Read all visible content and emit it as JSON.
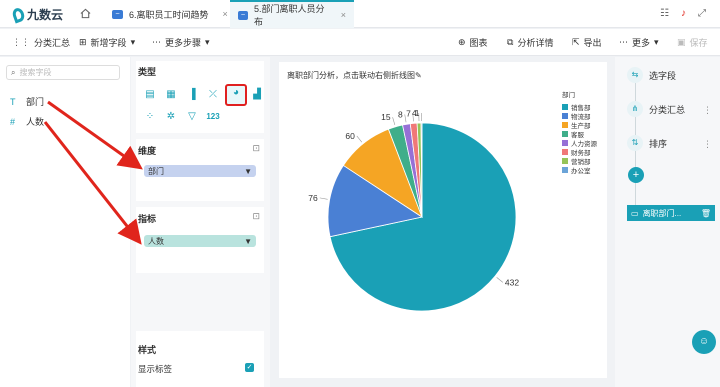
{
  "app": {
    "logo": "九数云"
  },
  "tabs": [
    {
      "label": "6.离职员工时间趋势",
      "icon": "chart-icon"
    },
    {
      "label": "5.部门离职人员分布",
      "icon": "chart-icon"
    }
  ],
  "toolbar": {
    "group_summary": "分类汇总",
    "add_field": "新增字段",
    "more_steps": "更多步骤",
    "chart": "图表",
    "analysis_detail": "分析详情",
    "export": "导出",
    "more": "更多",
    "save": "保存"
  },
  "left_panel": {
    "search_placeholder": "搜索字段",
    "fields": [
      {
        "type_icon": "T",
        "name": "部门"
      },
      {
        "type_icon": "#",
        "name": "人数"
      }
    ]
  },
  "mid_panel": {
    "type_title": "类型",
    "dimension_title": "维度",
    "dimension_value": "部门",
    "metric_title": "指标",
    "metric_value": "人数",
    "style_title": "样式",
    "show_label": "显示标签"
  },
  "chart_title": "离职部门分析，点击联动右侧折线图",
  "colors": {
    "accent": "#1aa0b6",
    "dimension_bg": "#c5d2ef",
    "metric_bg": "#b9e3de",
    "annotation": "#e0251c"
  },
  "chart_data": {
    "type": "pie",
    "legend_title": "部门",
    "categories": [
      "销售部",
      "物流部",
      "生产部",
      "客服",
      "人力资源",
      "财务部",
      "营销部",
      "办公室"
    ],
    "values": [
      432,
      76,
      60,
      15,
      8,
      7,
      4,
      1
    ],
    "colors": [
      "#1aa0b6",
      "#4a80d4",
      "#f5a524",
      "#3fae8a",
      "#9670d6",
      "#f07878",
      "#96c458",
      "#6ba4d8"
    ]
  },
  "right_panel": {
    "steps": [
      {
        "label": "选字段",
        "icon": "select-field-icon"
      },
      {
        "label": "分类汇总",
        "icon": "group-icon"
      },
      {
        "label": "排序",
        "icon": "sort-icon"
      }
    ],
    "final_label": "离职部门..."
  }
}
